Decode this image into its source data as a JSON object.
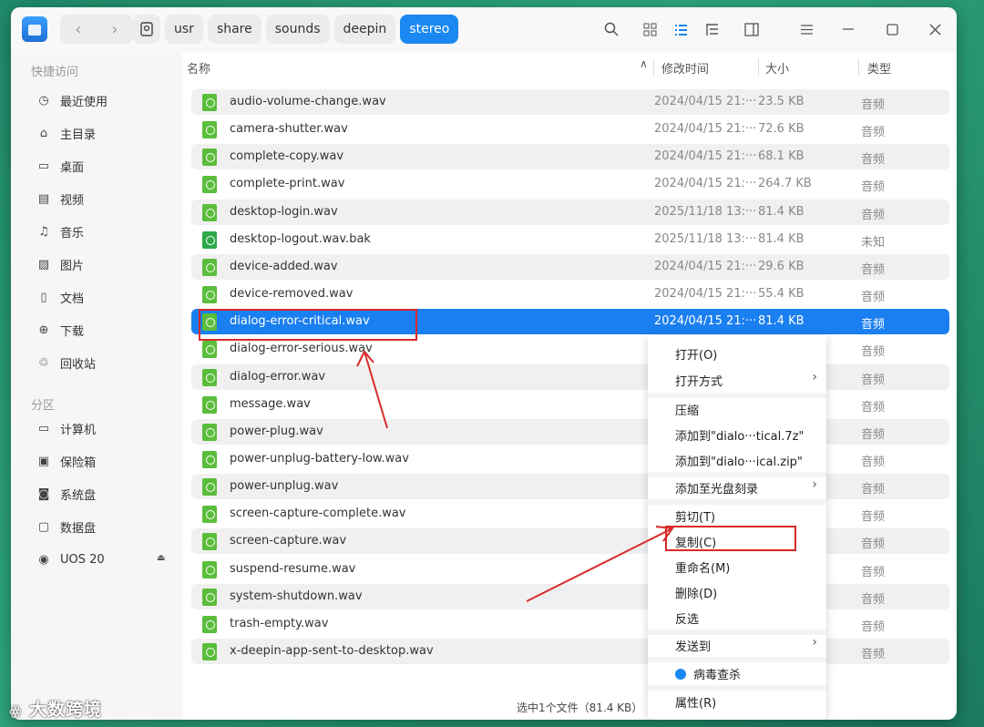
{
  "breadcrumbs": [
    "usr",
    "share",
    "sounds",
    "deepin",
    "stereo"
  ],
  "sidebar": {
    "quick_access_title": "快捷访问",
    "quick_items": [
      {
        "label": "最近使用",
        "icon": "clock-icon"
      },
      {
        "label": "主目录",
        "icon": "home-icon"
      },
      {
        "label": "桌面",
        "icon": "desktop-icon"
      },
      {
        "label": "视频",
        "icon": "video-icon"
      },
      {
        "label": "音乐",
        "icon": "music-icon"
      },
      {
        "label": "图片",
        "icon": "picture-icon"
      },
      {
        "label": "文档",
        "icon": "document-icon"
      },
      {
        "label": "下载",
        "icon": "download-icon"
      },
      {
        "label": "回收站",
        "icon": "trash-icon"
      }
    ],
    "partition_title": "分区",
    "partition_items": [
      {
        "label": "计算机",
        "icon": "computer-icon"
      },
      {
        "label": "保险箱",
        "icon": "vault-icon"
      },
      {
        "label": "系统盘",
        "icon": "disk-icon"
      },
      {
        "label": "数据盘",
        "icon": "disk-icon"
      },
      {
        "label": "UOS 20",
        "icon": "optical-disk-icon"
      }
    ]
  },
  "columns": {
    "name": "名称",
    "modified": "修改时间",
    "size": "大小",
    "type": "类型"
  },
  "files": [
    {
      "name": "audio-volume-change.wav",
      "date": "2024/04/15 21:···",
      "size": "23.5 KB",
      "type": "音频"
    },
    {
      "name": "camera-shutter.wav",
      "date": "2024/04/15 21:···",
      "size": "72.6 KB",
      "type": "音频"
    },
    {
      "name": "complete-copy.wav",
      "date": "2024/04/15 21:···",
      "size": "68.1 KB",
      "type": "音频"
    },
    {
      "name": "complete-print.wav",
      "date": "2024/04/15 21:···",
      "size": "264.7 KB",
      "type": "音频"
    },
    {
      "name": "desktop-login.wav",
      "date": "2025/11/18 13:···",
      "size": "81.4 KB",
      "type": "音频"
    },
    {
      "name": "desktop-logout.wav.bak",
      "date": "2025/11/18 13:···",
      "size": "81.4 KB",
      "type": "未知"
    },
    {
      "name": "device-added.wav",
      "date": "2024/04/15 21:···",
      "size": "29.6 KB",
      "type": "音频"
    },
    {
      "name": "device-removed.wav",
      "date": "2024/04/15 21:···",
      "size": "55.4 KB",
      "type": "音频"
    },
    {
      "name": "dialog-error-critical.wav",
      "date": "2024/04/15 21:···",
      "size": "81.4 KB",
      "type": "音频"
    },
    {
      "name": "dialog-error-serious.wav",
      "date": "",
      "size": "",
      "type": "音频"
    },
    {
      "name": "dialog-error.wav",
      "date": "",
      "size": "",
      "type": "音频"
    },
    {
      "name": "message.wav",
      "date": "",
      "size": "",
      "type": "音频"
    },
    {
      "name": "power-plug.wav",
      "date": "",
      "size": "",
      "type": "音频"
    },
    {
      "name": "power-unplug-battery-low.wav",
      "date": "",
      "size": "",
      "type": "音频"
    },
    {
      "name": "power-unplug.wav",
      "date": "",
      "size": "",
      "type": "音频"
    },
    {
      "name": "screen-capture-complete.wav",
      "date": "",
      "size": "",
      "type": "音频"
    },
    {
      "name": "screen-capture.wav",
      "date": "",
      "size": "",
      "type": "音频"
    },
    {
      "name": "suspend-resume.wav",
      "date": "",
      "size": "",
      "type": "音频"
    },
    {
      "name": "system-shutdown.wav",
      "date": "",
      "size": "",
      "type": "音频"
    },
    {
      "name": "trash-empty.wav",
      "date": "",
      "size": "",
      "type": "音频"
    },
    {
      "name": "x-deepin-app-sent-to-desktop.wav",
      "date": "",
      "size": "",
      "type": "音频"
    }
  ],
  "status_text": "选中1个文件（81.4 KB）",
  "context_menu": {
    "open": "打开(O)",
    "open_with": "打开方式",
    "compress": "压缩",
    "add_7z": "添加到\"dialo···tical.7z\"",
    "add_zip": "添加到\"dialo···ical.zip\"",
    "burn": "添加至光盘刻录",
    "cut": "剪切(T)",
    "copy": "复制(C)",
    "rename": "重命名(M)",
    "delete": "删除(D)",
    "invert": "反选",
    "send_to": "发送到",
    "virus_scan": "病毒查杀",
    "properties": "属性(R)"
  },
  "watermark": "大数跨境",
  "colors": {
    "accent": "#1a7ff0",
    "annotation": "#d92a2a",
    "audio_icon": "#5bbd3c"
  }
}
